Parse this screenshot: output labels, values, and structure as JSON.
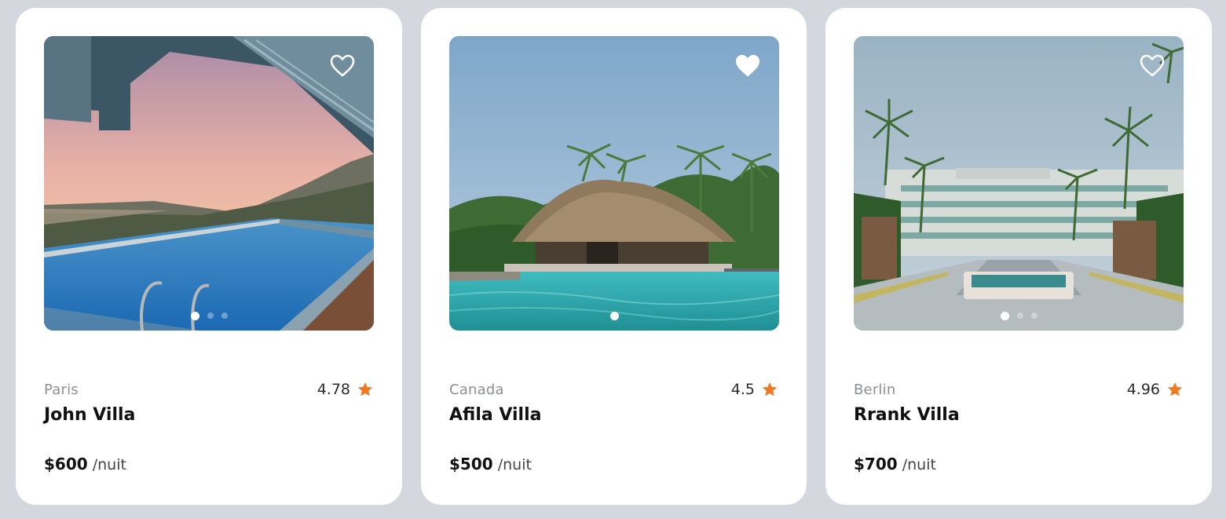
{
  "listings": [
    {
      "city": "Paris",
      "name": "John Villa",
      "rating": "4.78",
      "price": "$600",
      "unit": "/nuit",
      "favorite_icon": "heart-outline",
      "active_slide": 1,
      "slide_count": 3
    },
    {
      "city": "Canada",
      "name": "Afila Villa",
      "rating": "4.5",
      "price": "$500",
      "unit": "/nuit",
      "favorite_icon": "heart-filled",
      "active_slide": 1,
      "slide_count": 1
    },
    {
      "city": "Berlin",
      "name": "Rrank Villa",
      "rating": "4.96",
      "price": "$700",
      "unit": "/nuit",
      "favorite_icon": "heart-outline",
      "active_slide": 1,
      "slide_count": 3
    }
  ],
  "colors": {
    "star": "#ef7a22",
    "page_bg": "#d4d7de",
    "card_bg": "#ffffff"
  }
}
